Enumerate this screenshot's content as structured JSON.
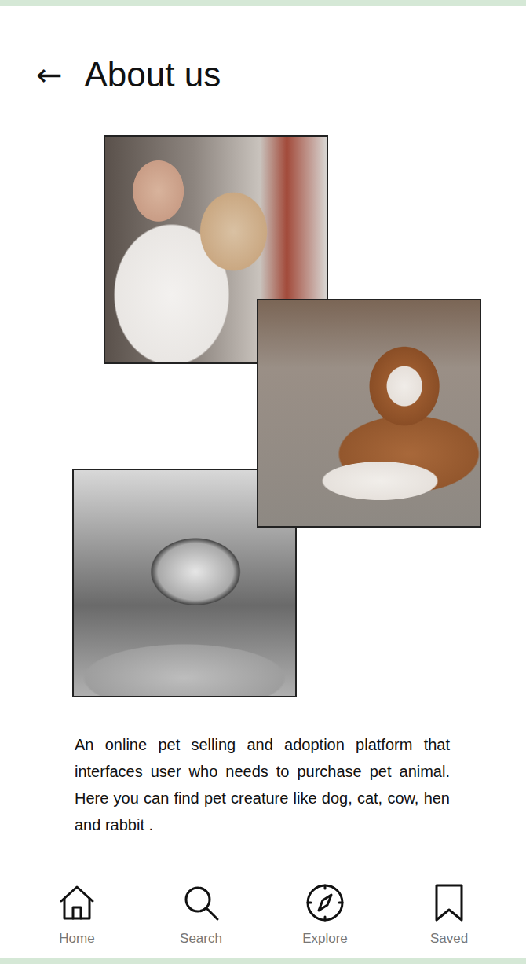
{
  "header": {
    "back": "←",
    "title": "About us"
  },
  "description": "An online pet selling and adoption platform that interfaces user who needs to purchase pet animal. Here you can find pet creature like dog, cat, cow, hen and rabbit .",
  "nav": [
    {
      "label": "Home"
    },
    {
      "label": "Search"
    },
    {
      "label": "Explore"
    },
    {
      "label": "Saved"
    }
  ]
}
